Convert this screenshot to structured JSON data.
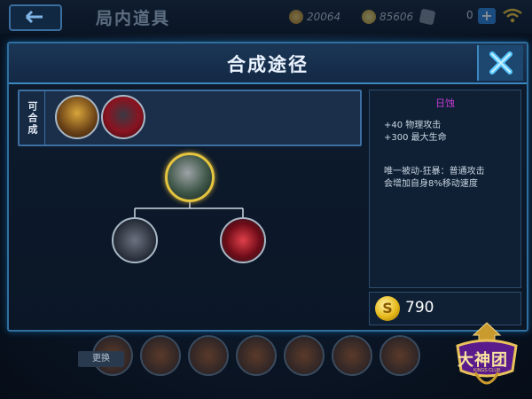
{
  "topbar": {
    "title": "局内道具",
    "currency1": "20064",
    "currency2": "85606",
    "currency3": "0",
    "add_symbol": "+"
  },
  "background": {
    "swap_label": "更换"
  },
  "modal": {
    "title": "合成途径",
    "close_icon": "close-x-icon",
    "compose_label": "可合成"
  },
  "item": {
    "name": "日蚀",
    "name_color": "#c13bd3",
    "stats": [
      "+40 物理攻击",
      "+300 最大生命"
    ],
    "passive": [
      "唯一被动-狂暴：普通攻击",
      "会增加自身8%移动速度"
    ],
    "price": "790"
  },
  "logo": {
    "text": "大神团",
    "subtext": "KINGS CLUB"
  },
  "colors": {
    "accent": "#3c88c1",
    "gold": "#e5c440"
  }
}
